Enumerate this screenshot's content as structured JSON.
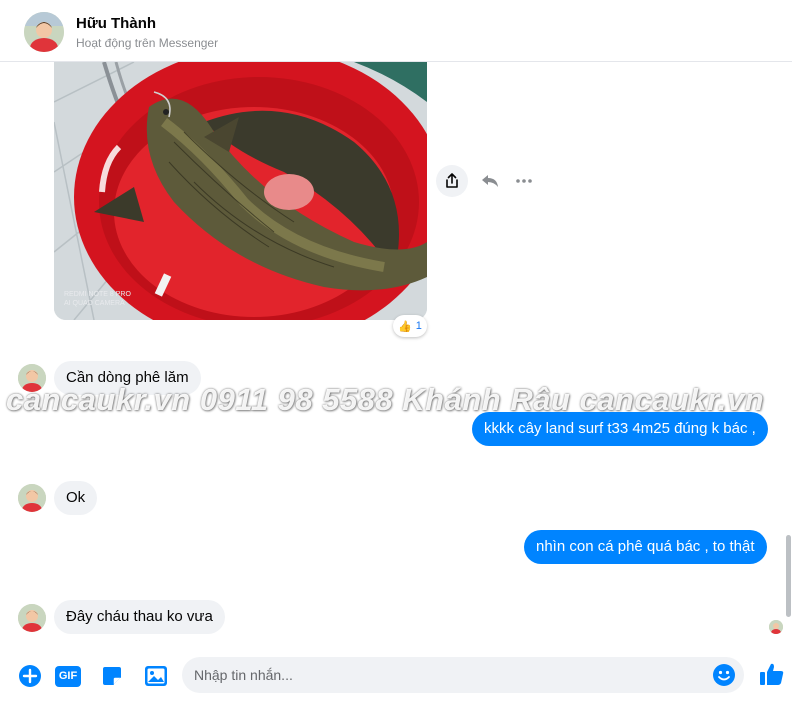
{
  "header": {
    "contact_name": "Hữu Thành",
    "status": "Hoạt động trên Messenger"
  },
  "photo": {
    "caption_line1": "REDMI NOTE 8 PRO",
    "caption_line2": "AI QUAD CAMERA",
    "reaction_emoji": "👍",
    "reaction_count": "1"
  },
  "messages": [
    {
      "from": "contact",
      "text": "Cần dòng phê lăm"
    },
    {
      "from": "me",
      "text": "kkkk cây land surf t33 4m25 đúng k bác ,"
    },
    {
      "from": "contact",
      "text": "Ok"
    },
    {
      "from": "me",
      "text": "nhìn con cá phê quá bác , to thật"
    },
    {
      "from": "contact",
      "text": "Đây cháu thau ko vưa"
    }
  ],
  "watermark": "cancaukr.vn 0911 98 5588 Khánh Râu cancaukr.vn",
  "composer": {
    "placeholder": "Nhập tin nhắn...",
    "gif_label": "GIF"
  },
  "icons": {
    "add": "plus-circle-icon",
    "gif": "gif-icon",
    "sticker": "sticker-icon",
    "image": "image-icon",
    "emoji": "emoji-icon",
    "like": "thumbs-up-icon",
    "share": "share-icon",
    "reply": "reply-icon",
    "more": "more-icon"
  },
  "colors": {
    "accent": "#0084ff",
    "incoming_bubble": "#f0f2f5",
    "bucket_red": "#d4141f"
  }
}
